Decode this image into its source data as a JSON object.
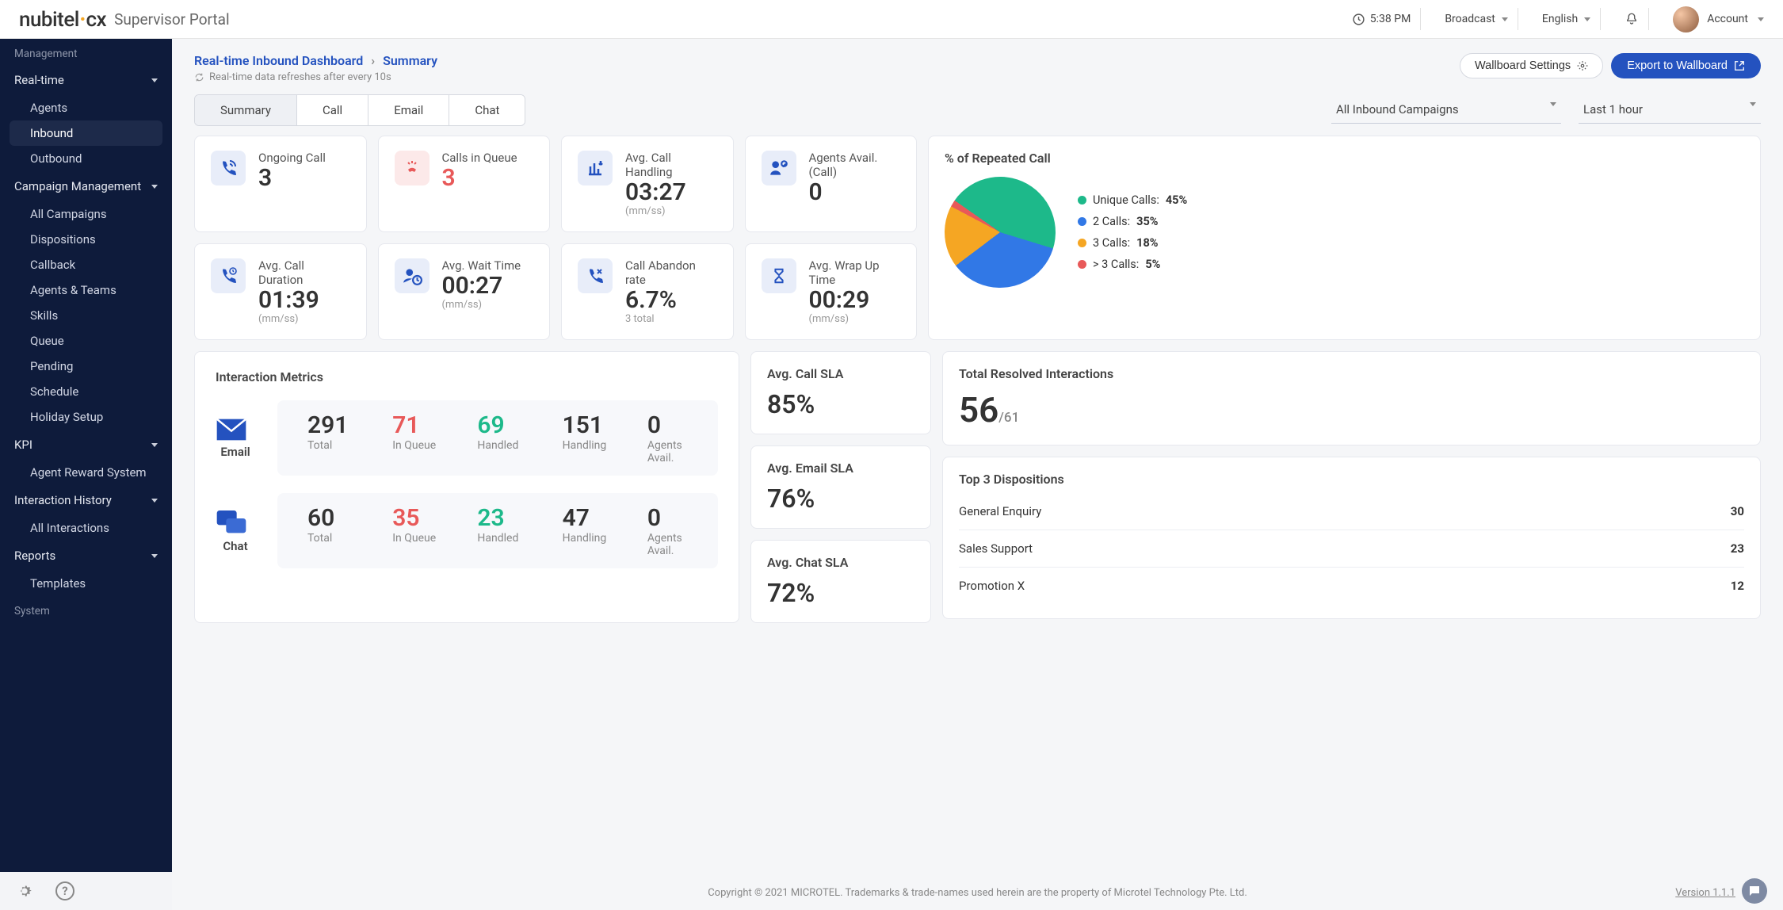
{
  "brand": {
    "name": "nubitel",
    "suffix": "cx",
    "portal": "Supervisor Portal"
  },
  "topbar": {
    "time": "5:38 PM",
    "broadcast": "Broadcast",
    "language": "English",
    "account": "Account"
  },
  "sidebar": {
    "sections": {
      "management": "Management",
      "realtime": "Real-time",
      "realtime_children": [
        "Agents",
        "Inbound",
        "Outbound"
      ],
      "campaign": "Campaign Management",
      "campaign_children": [
        "All Campaigns",
        "Dispositions",
        "Callback",
        "Agents & Teams",
        "Skills",
        "Queue",
        "Pending",
        "Schedule",
        "Holiday Setup"
      ],
      "kpi": "KPI",
      "kpi_children": [
        "Agent Reward System"
      ],
      "history": "Interaction History",
      "history_children": [
        "All Interactions"
      ],
      "reports": "Reports",
      "reports_children": [
        "Templates"
      ],
      "system": "System"
    }
  },
  "breadcrumb": {
    "a": "Real-time Inbound Dashboard",
    "b": "Summary"
  },
  "refresh": "Real-time data refreshes after every 10s",
  "buttons": {
    "wallboard_settings": "Wallboard Settings",
    "export": "Export to Wallboard"
  },
  "tabs": [
    "Summary",
    "Call",
    "Email",
    "Chat"
  ],
  "filters": {
    "campaign": "All Inbound Campaigns",
    "range": "Last 1 hour"
  },
  "metrics": {
    "ongoing": {
      "label": "Ongoing Call",
      "value": "3"
    },
    "queue": {
      "label": "Calls in Queue",
      "value": "3"
    },
    "handling": {
      "label": "Avg. Call Handling",
      "value": "03:27",
      "sub": "(mm/ss)"
    },
    "agents_avail": {
      "label": "Agents Avail. (Call)",
      "value": "0"
    },
    "duration": {
      "label": "Avg. Call Duration",
      "value": "01:39",
      "sub": "(mm/ss)"
    },
    "wait": {
      "label": "Avg. Wait Time",
      "value": "00:27",
      "sub": "(mm/ss)"
    },
    "abandon": {
      "label": "Call Abandon rate",
      "value": "6.7%",
      "sub": "3 total"
    },
    "wrap": {
      "label": "Avg. Wrap Up Time",
      "value": "00:29",
      "sub": "(mm/ss)"
    }
  },
  "repeated": {
    "title": "% of Repeated Call",
    "legend": [
      {
        "label": "Unique Calls:",
        "value": "45%",
        "color": "#1db98a"
      },
      {
        "label": "2 Calls:",
        "value": "35%",
        "color": "#3178e6"
      },
      {
        "label": "3 Calls:",
        "value": "18%",
        "color": "#f5a623"
      },
      {
        "label": "> 3 Calls:",
        "value": "5%",
        "color": "#e85959"
      }
    ]
  },
  "chart_data": {
    "type": "pie",
    "title": "% of Repeated Call",
    "series": [
      {
        "name": "Unique Calls",
        "value": 45,
        "color": "#1db98a"
      },
      {
        "name": "2 Calls",
        "value": 35,
        "color": "#3178e6"
      },
      {
        "name": "3 Calls",
        "value": 18,
        "color": "#f5a623"
      },
      {
        "name": "> 3 Calls",
        "value": 5,
        "color": "#e85959"
      }
    ]
  },
  "interactions": {
    "title": "Interaction Metrics",
    "email": {
      "label": "Email",
      "total": {
        "v": "291",
        "l": "Total"
      },
      "queue": {
        "v": "71",
        "l": "In Queue"
      },
      "handled": {
        "v": "69",
        "l": "Handled"
      },
      "handling": {
        "v": "151",
        "l": "Handling"
      },
      "avail": {
        "v": "0",
        "l": "Agents Avail."
      }
    },
    "chat": {
      "label": "Chat",
      "total": {
        "v": "60",
        "l": "Total"
      },
      "queue": {
        "v": "35",
        "l": "In Queue"
      },
      "handled": {
        "v": "23",
        "l": "Handled"
      },
      "handling": {
        "v": "47",
        "l": "Handling"
      },
      "avail": {
        "v": "0",
        "l": "Agents Avail."
      }
    }
  },
  "sla": {
    "call": {
      "label": "Avg. Call SLA",
      "value": "85%"
    },
    "email": {
      "label": "Avg. Email SLA",
      "value": "76%"
    },
    "chat": {
      "label": "Avg. Chat SLA",
      "value": "72%"
    }
  },
  "resolved": {
    "label": "Total Resolved Interactions",
    "value": "56",
    "denom": "/61"
  },
  "dispositions": {
    "title": "Top 3 Dispositions",
    "rows": [
      {
        "name": "General Enquiry",
        "count": "30"
      },
      {
        "name": "Sales Support",
        "count": "23"
      },
      {
        "name": "Promotion X",
        "count": "12"
      }
    ]
  },
  "footer": {
    "copyright": "Copyright © 2021 MICROTEL. Trademarks & trade-names used herein are the property of Microtel Technology Pte. Ltd.",
    "version": "Version 1.1.1"
  }
}
